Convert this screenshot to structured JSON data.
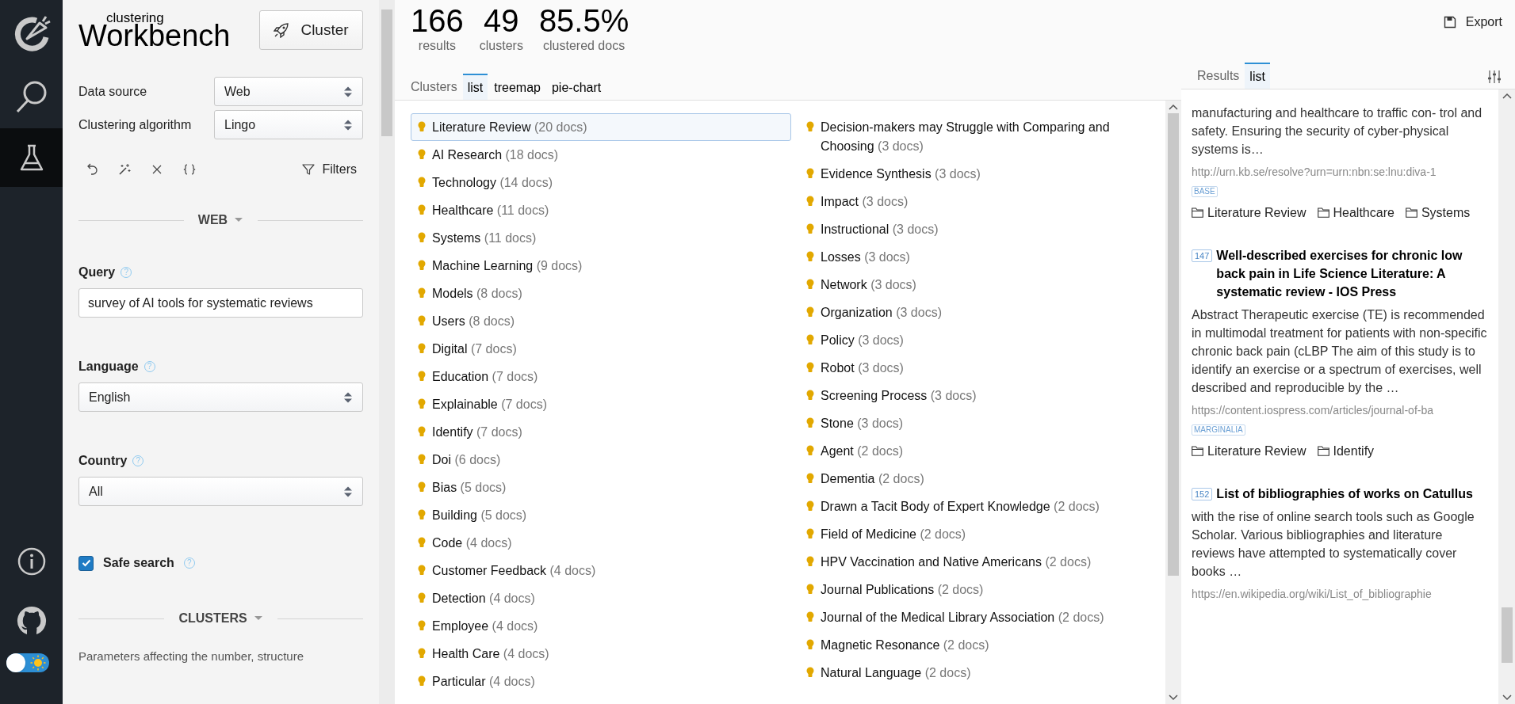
{
  "nav_items": [
    {
      "kind": "search",
      "selected": false
    },
    {
      "kind": "lab",
      "selected": true
    }
  ],
  "theme_toggle": {
    "dark": false
  },
  "sidebar": {
    "logo_small": "clustering",
    "logo_big": "Workbench",
    "cluster_button": "Cluster",
    "settings": [
      {
        "label": "Data source",
        "value": "Web"
      },
      {
        "label": "Clustering algorithm",
        "value": "Lingo"
      }
    ],
    "filters": "Filters",
    "sections": [
      {
        "heading": "WEB",
        "fields": [
          {
            "kind": "text",
            "label": "Query",
            "hint": "?",
            "value": "survey of AI tools for systematic reviews"
          },
          {
            "kind": "select",
            "label": "Language",
            "hint": "?",
            "value": "English"
          },
          {
            "kind": "select",
            "label": "Country",
            "hint": "?",
            "value": "All"
          },
          {
            "kind": "checkbox",
            "label": "Safe search",
            "hint": "?",
            "checked": true
          }
        ]
      },
      {
        "heading": "CLUSTERS",
        "description": "Parameters affecting the number, structure"
      }
    ]
  },
  "stats": [
    {
      "value": "166",
      "label": "results"
    },
    {
      "value": "49",
      "label": "clusters"
    },
    {
      "value": "85.5%",
      "label": "clustered docs"
    }
  ],
  "cluster_view": {
    "title": "Clusters",
    "tabs": [
      {
        "label": "list",
        "selected": true
      },
      {
        "label": "treemap",
        "selected": false
      },
      {
        "label": "pie-chart",
        "selected": false
      }
    ]
  },
  "clusters": [
    {
      "label": "Literature Review",
      "count": "(20 docs)",
      "selected": true
    },
    {
      "label": "AI Research",
      "count": "(18 docs)",
      "selected": false
    },
    {
      "label": "Technology",
      "count": "(14 docs)",
      "selected": false
    },
    {
      "label": "Healthcare",
      "count": "(11 docs)",
      "selected": false
    },
    {
      "label": "Systems",
      "count": "(11 docs)",
      "selected": false
    },
    {
      "label": "Machine Learning",
      "count": "(9 docs)",
      "selected": false
    },
    {
      "label": "Models",
      "count": "(8 docs)",
      "selected": false
    },
    {
      "label": "Users",
      "count": "(8 docs)",
      "selected": false
    },
    {
      "label": "Digital",
      "count": "(7 docs)",
      "selected": false
    },
    {
      "label": "Education",
      "count": "(7 docs)",
      "selected": false
    },
    {
      "label": "Explainable",
      "count": "(7 docs)",
      "selected": false
    },
    {
      "label": "Identify",
      "count": "(7 docs)",
      "selected": false
    },
    {
      "label": "Doi",
      "count": "(6 docs)",
      "selected": false
    },
    {
      "label": "Bias",
      "count": "(5 docs)",
      "selected": false
    },
    {
      "label": "Building",
      "count": "(5 docs)",
      "selected": false
    },
    {
      "label": "Code",
      "count": "(4 docs)",
      "selected": false
    },
    {
      "label": "Customer Feedback",
      "count": "(4 docs)",
      "selected": false
    },
    {
      "label": "Detection",
      "count": "(4 docs)",
      "selected": false
    },
    {
      "label": "Employee",
      "count": "(4 docs)",
      "selected": false
    },
    {
      "label": "Health Care",
      "count": "(4 docs)",
      "selected": false
    },
    {
      "label": "Particular",
      "count": "(4 docs)",
      "selected": false
    },
    {
      "label": "Decision-makers may Struggle with Comparing and Choosing",
      "count": "(3 docs)",
      "selected": false
    },
    {
      "label": "Evidence Synthesis",
      "count": "(3 docs)",
      "selected": false
    },
    {
      "label": "Impact",
      "count": "(3 docs)",
      "selected": false
    },
    {
      "label": "Instructional",
      "count": "(3 docs)",
      "selected": false
    },
    {
      "label": "Losses",
      "count": "(3 docs)",
      "selected": false
    },
    {
      "label": "Network",
      "count": "(3 docs)",
      "selected": false
    },
    {
      "label": "Organization",
      "count": "(3 docs)",
      "selected": false
    },
    {
      "label": "Policy",
      "count": "(3 docs)",
      "selected": false
    },
    {
      "label": "Robot",
      "count": "(3 docs)",
      "selected": false
    },
    {
      "label": "Screening Process",
      "count": "(3 docs)",
      "selected": false
    },
    {
      "label": "Stone",
      "count": "(3 docs)",
      "selected": false
    },
    {
      "label": "Agent",
      "count": "(2 docs)",
      "selected": false
    },
    {
      "label": "Dementia",
      "count": "(2 docs)",
      "selected": false
    },
    {
      "label": "Drawn a Tacit Body of Expert Knowledge",
      "count": "(2 docs)",
      "selected": false
    },
    {
      "label": "Field of Medicine",
      "count": "(2 docs)",
      "selected": false
    },
    {
      "label": "HPV Vaccination and Native Americans",
      "count": "(2 docs)",
      "selected": false
    },
    {
      "label": "Journal Publications",
      "count": "(2 docs)",
      "selected": false
    },
    {
      "label": "Journal of the Medical Library Association",
      "count": "(2 docs)",
      "selected": false
    },
    {
      "label": "Magnetic Resonance",
      "count": "(2 docs)",
      "selected": false
    },
    {
      "label": "Natural Language",
      "count": "(2 docs)",
      "selected": false
    }
  ],
  "export": "Export",
  "results_view": {
    "title": "Results",
    "tabs": [
      {
        "label": "list",
        "selected": true
      }
    ]
  },
  "results": [
    {
      "snippet": "manufacturing and healthcare to traffic con- trol and safety. Ensuring the security of cyber-physical systems is…",
      "url": "http://urn.kb.se/resolve?urn=urn:nbn:se:lnu:diva-1",
      "source": "BASE",
      "clusters": [
        "Literature Review",
        "Healthcare",
        "Systems"
      ]
    },
    {
      "number": "147",
      "title": "Well-described exercises for chronic low back pain in Life Science Literature: A systematic review - IOS Press",
      "snippet": "Abstract Therapeutic exercise (TE) is recommended in multimodal treatment for patients with non-specific chronic back pain (cLBP The aim of this study is to identify an exercise or a spectrum of exercises, well described and reproducible by the …",
      "url": "https://content.iospress.com/articles/journal-of-ba",
      "source": "MARGINALIA",
      "clusters": [
        "Literature Review",
        "Identify"
      ]
    },
    {
      "number": "152",
      "title": "List of bibliographies of works on Catullus",
      "snippet": "with the rise of online search tools such as Google Scholar. Various bibliographies and literature reviews have attempted to systematically cover books …",
      "url": "https://en.wikipedia.org/wiki/List_of_bibliographie"
    }
  ]
}
